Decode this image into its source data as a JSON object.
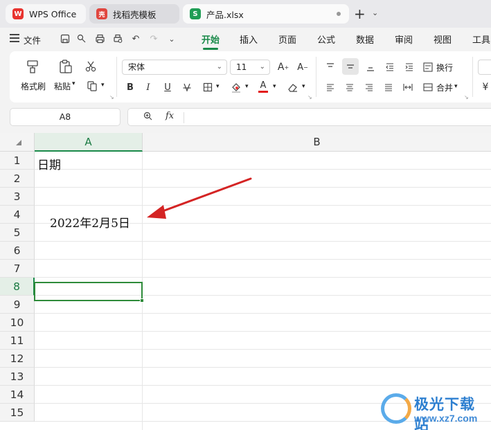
{
  "tabs": [
    {
      "label": "WPS Office",
      "logo": "W"
    },
    {
      "label": "找稻壳模板",
      "logo": "壳"
    },
    {
      "label": "产品.xlsx",
      "logo": "S"
    }
  ],
  "menubar": {
    "file": "文件",
    "tabs": [
      "开始",
      "插入",
      "页面",
      "公式",
      "数据",
      "审阅",
      "视图",
      "工具"
    ],
    "active": "开始"
  },
  "ribbon": {
    "format_painter": "格式刷",
    "paste": "粘贴",
    "font_name": "宋体",
    "font_size": "11",
    "bold": "B",
    "italic": "I",
    "underline": "U",
    "font_color_letter": "A",
    "wrap_text": "换行",
    "merge": "合并"
  },
  "formula_bar": {
    "name_box": "A8",
    "fx": "fx",
    "content": ""
  },
  "sheet": {
    "columns": [
      "A",
      "B"
    ],
    "rows": [
      "1",
      "2",
      "3",
      "4",
      "5",
      "6",
      "7",
      "8",
      "9",
      "10",
      "11",
      "12",
      "13",
      "14",
      "15"
    ],
    "selected_row": "8",
    "selected_col": "A",
    "cells": {
      "A1": "日期",
      "A4": "2022年2月5日"
    }
  },
  "colors": {
    "accent": "#1a8a4a",
    "annotation_arrow": "#d42424",
    "selection": "#2e8b3a"
  },
  "watermark": {
    "name": "极光下载站",
    "url": "www.xz7.com"
  }
}
